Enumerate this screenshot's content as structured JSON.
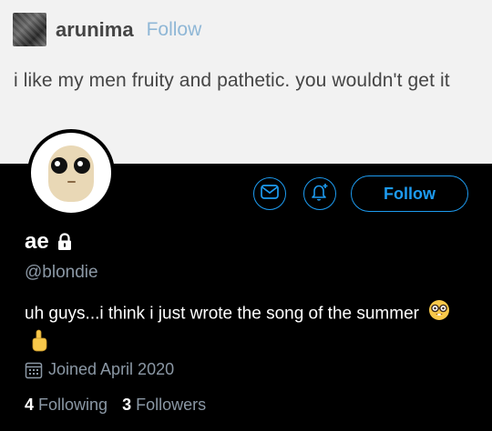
{
  "post": {
    "username": "arunima",
    "follow_label": "Follow",
    "text": "i like my men fruity and pathetic. you wouldn't get it"
  },
  "profile": {
    "display_name": "ae",
    "handle": "@blondie",
    "bio": "uh guys...i think i just wrote the song of the summer",
    "joined": "Joined April 2020",
    "following_count": "4",
    "following_label": "Following",
    "followers_count": "3",
    "followers_label": "Followers",
    "follow_button_label": "Follow",
    "accent_color": "#1d9bf0"
  },
  "icons": [
    "mail-icon",
    "bell-plus-icon",
    "lock-icon",
    "calendar-icon",
    "nerd-face-emoji",
    "pointing-up-emoji"
  ]
}
